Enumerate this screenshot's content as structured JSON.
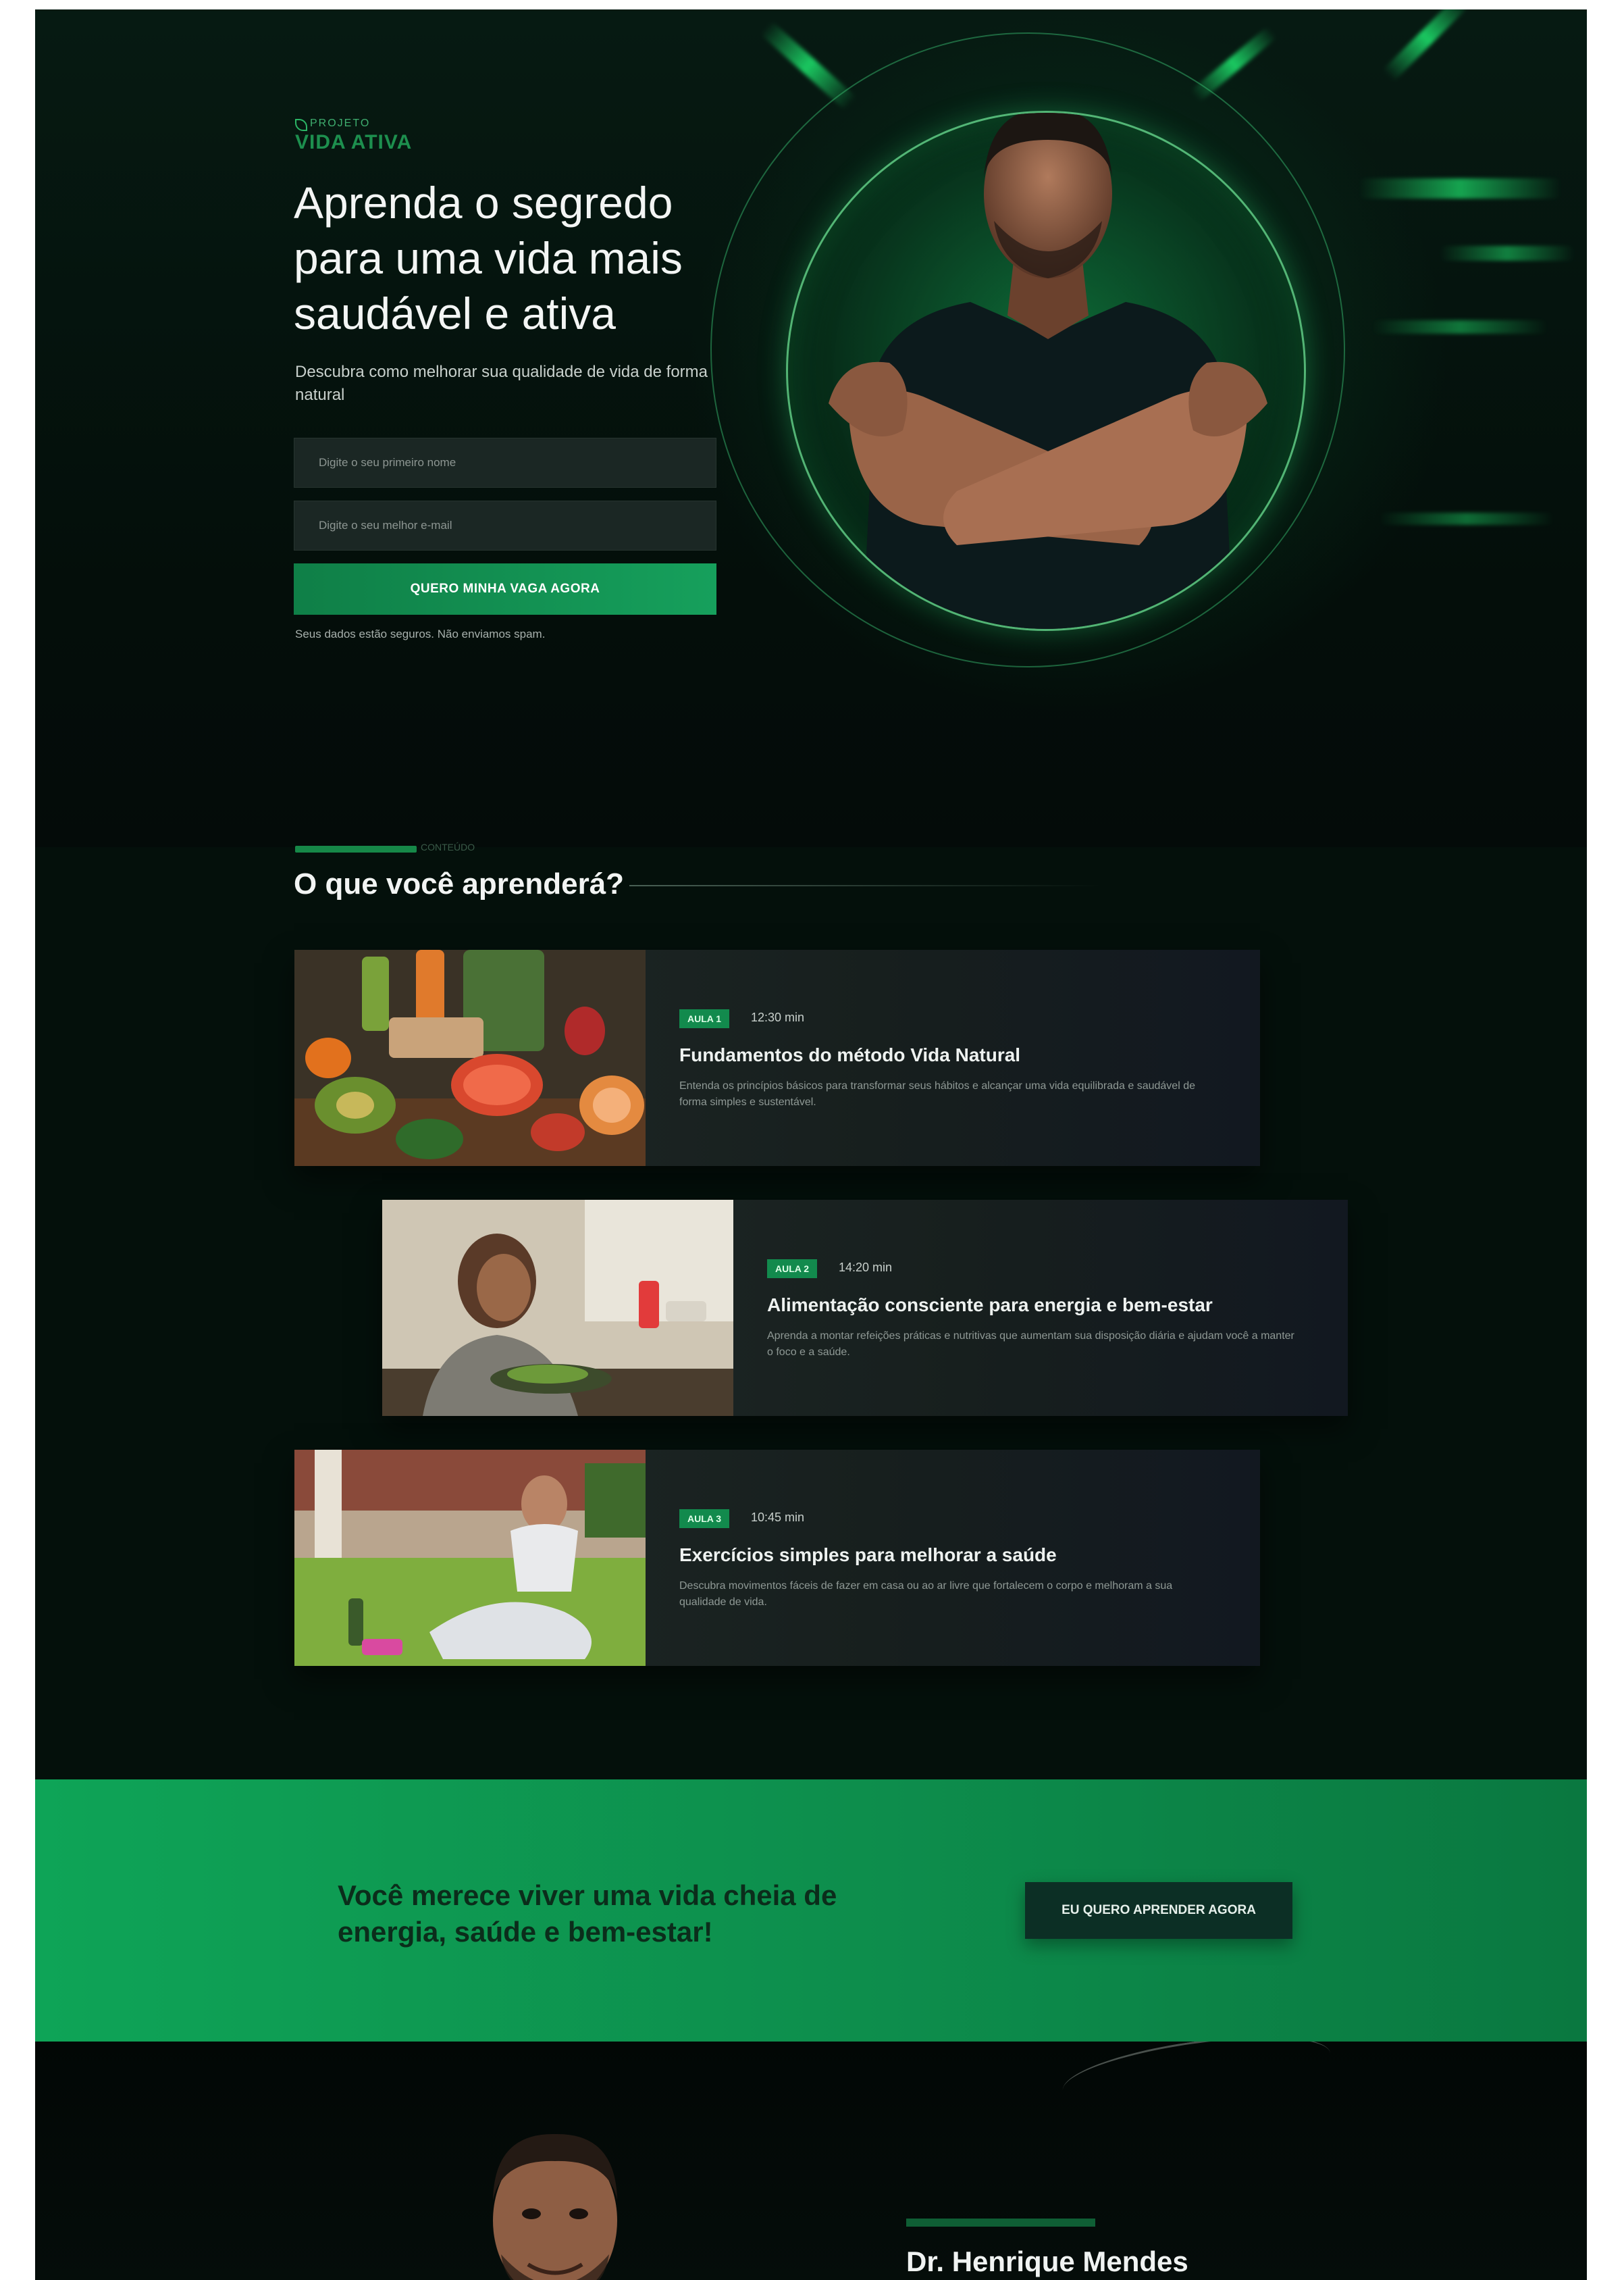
{
  "hero": {
    "logo_top": "PROJETO",
    "logo_main": "VIDA ATIVA",
    "title": "Aprenda o segredo para uma vida mais saudável e ativa",
    "subtitle": "Descubra como melhorar sua qualidade de vida de forma natural",
    "field_name_placeholder": "Digite o seu primeiro nome",
    "field_email_placeholder": "Digite o seu melhor e-mail",
    "cta_label": "QUERO MINHA VAGA AGORA",
    "note": "Seus dados estão seguros. Não enviamos spam."
  },
  "lessons_section": {
    "kicker": "CONTEÚDO",
    "title": "O que você aprenderá?",
    "items": [
      {
        "badge": "AULA 1",
        "duration": "12:30 min",
        "title": "Fundamentos do método Vida Natural",
        "description": "Entenda os princípios básicos para transformar seus hábitos e alcançar uma vida equilibrada e saudável de forma simples e sustentável."
      },
      {
        "badge": "AULA 2",
        "duration": "14:20 min",
        "title": "Alimentação consciente para energia e bem-estar",
        "description": "Aprenda a montar refeições práticas e nutritivas que aumentam sua disposição diária e ajudam você a manter o foco e a saúde."
      },
      {
        "badge": "AULA 3",
        "duration": "10:45 min",
        "title": "Exercícios simples para melhorar a saúde",
        "description": "Descubra movimentos fáceis de fazer em casa ou ao ar livre que fortalecem o corpo e melhoram a sua qualidade de vida."
      }
    ]
  },
  "band": {
    "text": "Você merece viver uma vida cheia de energia, saúde e bem-estar!",
    "button_label": "EU QUERO APRENDER AGORA"
  },
  "author": {
    "name": "Dr. Henrique Mendes"
  },
  "colors": {
    "accent": "#16a05c",
    "background": "#04100b",
    "band": "#0ea457"
  }
}
